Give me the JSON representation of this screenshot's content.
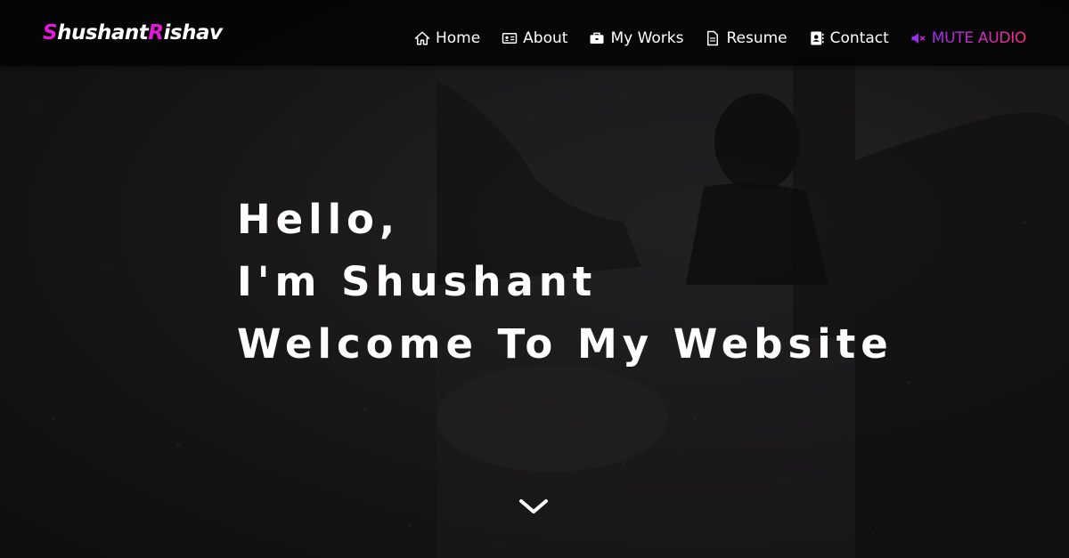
{
  "logo": {
    "first_initial": "S",
    "first_rest": "hushant",
    "last_initial": "R",
    "last_rest": "ishav"
  },
  "nav": {
    "items": [
      {
        "label": "Home",
        "icon": "home-icon"
      },
      {
        "label": "About",
        "icon": "id-card-icon"
      },
      {
        "label": "My Works",
        "icon": "briefcase-icon"
      },
      {
        "label": "Resume",
        "icon": "document-icon"
      },
      {
        "label": "Contact",
        "icon": "address-book-icon"
      }
    ],
    "mute": {
      "label": "MUTE AUDIO",
      "icon": "speaker-mute-icon"
    }
  },
  "hero": {
    "line1": "Hello,",
    "line2": "I'm Shushant",
    "line3": "Welcome To My Website"
  },
  "scroll": {
    "icon": "chevron-down-icon"
  },
  "colors": {
    "accent_magenta": "#e01ad6",
    "mute_gradient_start": "#9b2cf0",
    "mute_gradient_end": "#ff2b8a",
    "background": "#141414"
  }
}
